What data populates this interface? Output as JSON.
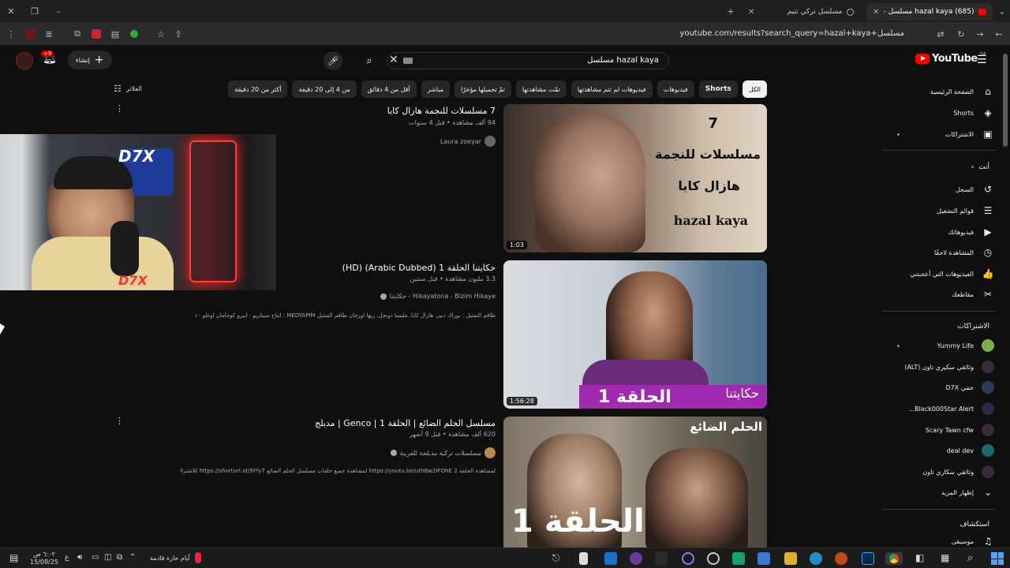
{
  "browser": {
    "tabs": [
      {
        "title": "(685) hazal kaya مسلسل - YouTube",
        "active": true
      },
      {
        "title": "مسلسل تركي تتيم",
        "active": false
      }
    ],
    "url": "youtube.com/results?search_query=hazal+kaya+مسلسل"
  },
  "youtube": {
    "logo": "YouTube",
    "region": "SA",
    "search_query": "hazal kaya مسلسل",
    "create_label": "إنشاء",
    "notification_count": "+9",
    "chips": [
      "الكل",
      "Shorts",
      "فيديوهات",
      "فيديوهات لم تتم مشاهدتها",
      "تمّت مشاهدتها",
      "تمّ تحميلها مؤخرًا",
      "مباشر",
      "أقل من 4 دقائق",
      "من 4 إلى 20 دقيقة",
      "أكثر من 20 دقيقة"
    ],
    "filters_label": "الفلاتر"
  },
  "results": [
    {
      "title": "7 مسلسلات للنجمة هازال كايا",
      "meta": "94 ألف مشاهدة • قبل 4 سنوات",
      "channel": "Laura zoeyar",
      "duration": "1:03",
      "thumb_lines": [
        "7",
        "مسلسلات للنجمة",
        "هازال كايا",
        "hazal kaya"
      ],
      "description": ""
    },
    {
      "title": "حكايتنا الحلقة 1 (Arabic Dubbed) (HD)",
      "meta": "3.3 مليون مشاهدة • قبل سنتين",
      "channel": "Hikayatona - Bizim Hikaye - حكايتنا",
      "duration": "1:56:28",
      "thumb_lines": [
        "الحلقة 1",
        "حكايتنا"
      ],
      "description": "طاقم التمثيل : بوراك دنيز، هازال كايا، مليسا دونجل، ريها اوزجان طاقم التمثيل MEDYAPIM : انتاج سيناريو : ابيرو كوجامان اوغلو - فيدا بارس ..."
    },
    {
      "title": "مسلسل الحلم الضائع | الحلقة 1 | Genco | مدبلج",
      "meta": "620 ألف مشاهدة • قبل 9 أشهر",
      "channel": "مسلسلات تركية مدبلجة للعربية",
      "duration": "",
      "thumb_lines": [
        "الحلم الضائع",
        "الحلقة 1"
      ],
      "description": "لمشاهدة الحلقة 2 https://youtu.be/uthBw2IFOhE لمشاهدة جميع حلقات مسلسل الحلم الضائع https://shorturl.at/5Ffy7 للاشتراك بقناة ..."
    }
  ],
  "sidebar": {
    "main": [
      {
        "label": "الصفحة الرئيسية",
        "icon": "home-icon",
        "glyph": "⌂"
      },
      {
        "label": "Shorts",
        "icon": "shorts-icon",
        "glyph": "◈"
      },
      {
        "label": "الاشتراكات",
        "icon": "subscriptions-icon",
        "glyph": "▣"
      }
    ],
    "you_header": "أنت",
    "you": [
      {
        "label": "السجل",
        "icon": "history-icon",
        "glyph": "↺"
      },
      {
        "label": "قوائم التشغيل",
        "icon": "playlists-icon",
        "glyph": "☰"
      },
      {
        "label": "فيديوهاتك",
        "icon": "your-videos-icon",
        "glyph": "▶"
      },
      {
        "label": "المشاهدة لاحقًا",
        "icon": "watch-later-icon",
        "glyph": "◷"
      },
      {
        "label": "الفيديوهات التي أعجبتني",
        "icon": "like-icon",
        "glyph": "👍"
      },
      {
        "label": "مقاطعك",
        "icon": "clips-icon",
        "glyph": "✂"
      }
    ],
    "subs_header": "الاشتراكات",
    "subs": [
      {
        "label": "Yummy Life",
        "color": "#7fae4a",
        "dot": true
      },
      {
        "label": "وثائقي سكيري تاون (ALT)",
        "color": "#3a2a3a",
        "dot": false
      },
      {
        "label": "حمي D7X",
        "color": "#2a3a5a",
        "dot": false
      },
      {
        "label": "Black000Star Alert...",
        "color": "#2a2a4a",
        "dot": false
      },
      {
        "label": "Scary Tawn cfw",
        "color": "#3a2a3a",
        "dot": false
      },
      {
        "label": "deal dev",
        "color": "#1a6a6a",
        "dot": false
      },
      {
        "label": "وثائقي سكاري تاون",
        "color": "#3a2a3a",
        "dot": false
      }
    ],
    "show_more": "إظهار المزيد",
    "explore_header": "استكشاف",
    "explore": [
      {
        "label": "موسيقى",
        "icon": "music-icon",
        "glyph": "♫"
      }
    ]
  },
  "taskbar": {
    "weather": "أيام حارة قادمة",
    "time": "٦:٠٢ ص",
    "date": "15/08/25",
    "lang": "ع"
  },
  "colors": {
    "accent": "#ff0000",
    "link": "#3ea6ff",
    "thumb2_bar": "#a02bb0"
  }
}
